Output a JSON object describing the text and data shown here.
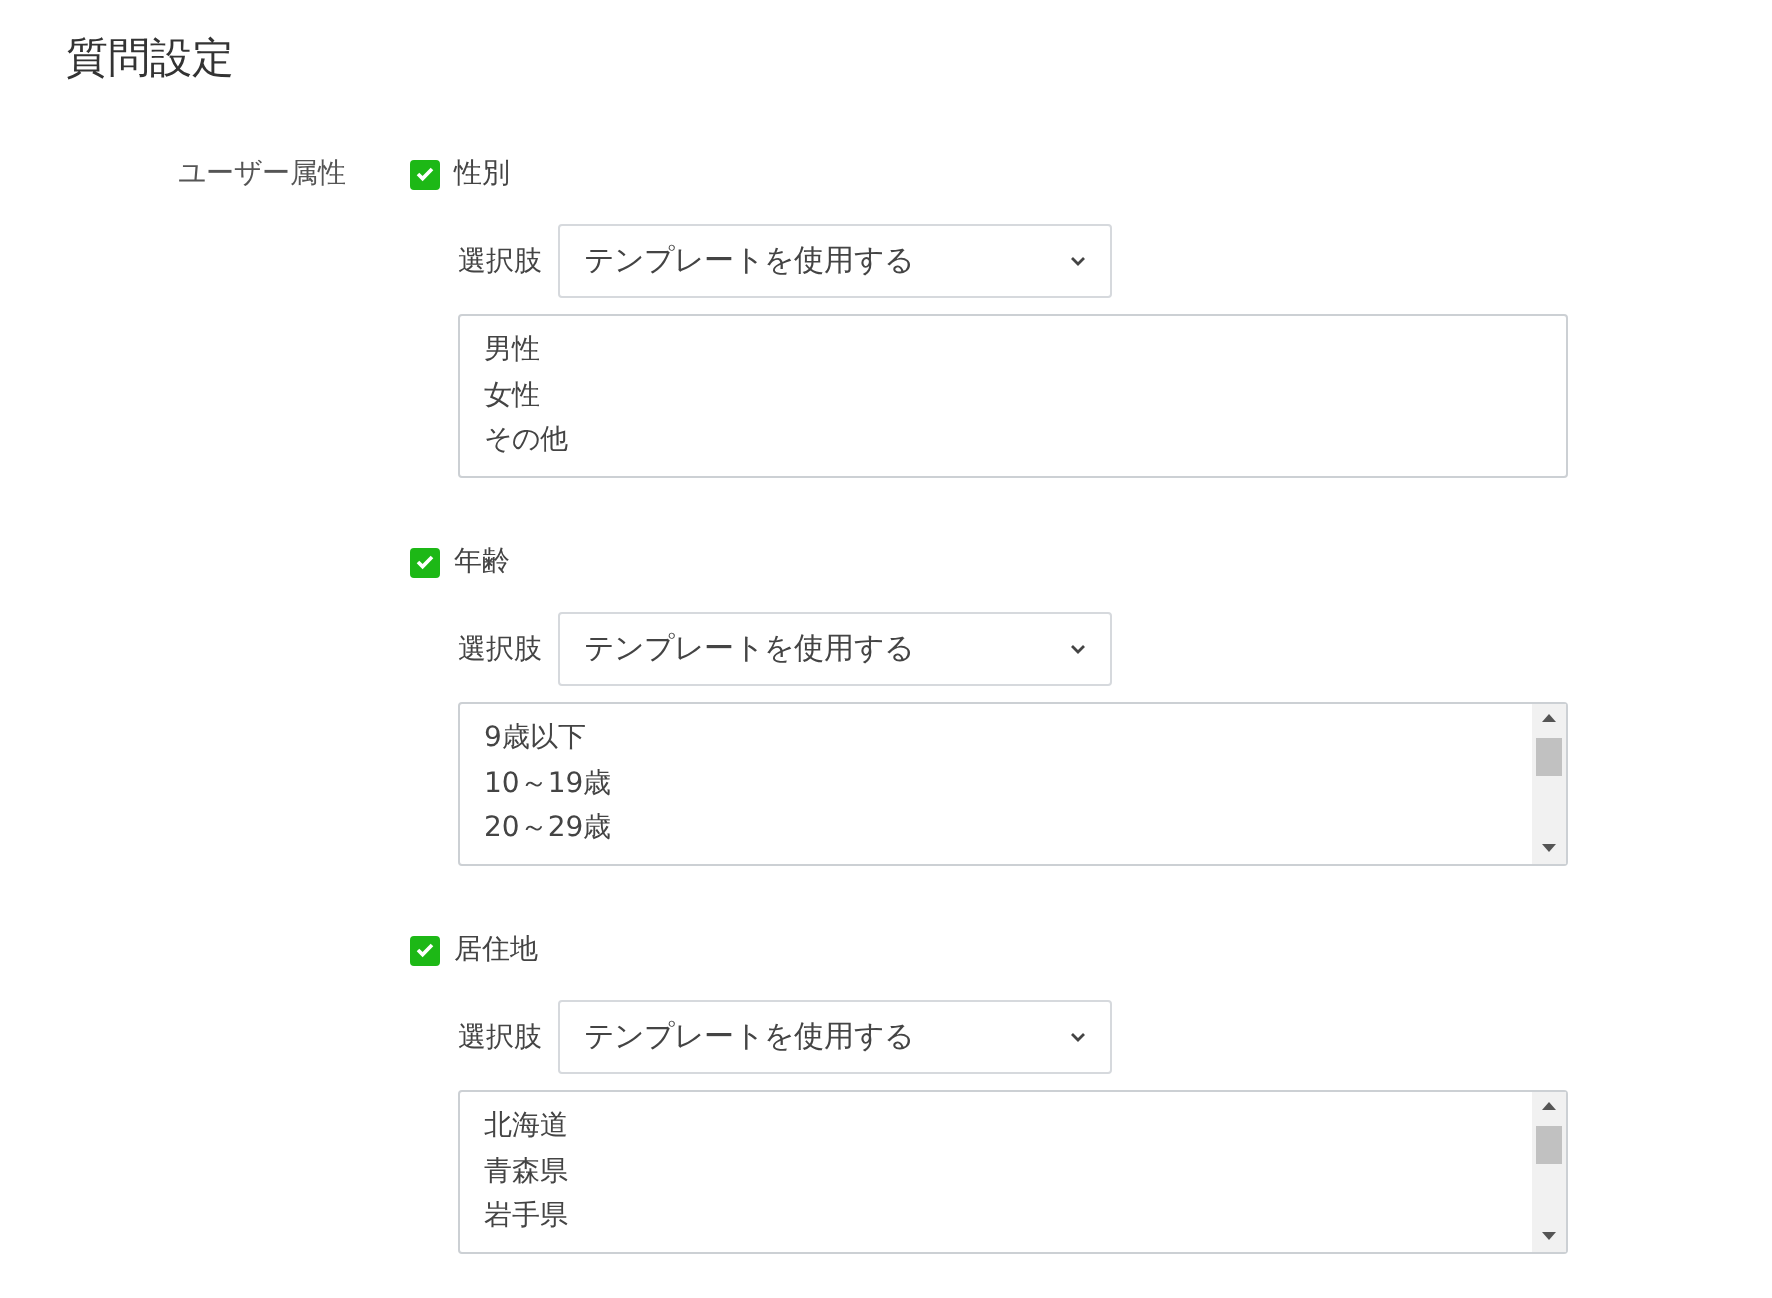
{
  "title": "質問設定",
  "group_label": "ユーザー属性",
  "attributes": [
    {
      "label": "性別",
      "checked": true,
      "choices_label": "選択肢",
      "select_value": "テンプレートを使用する",
      "options": [
        "男性",
        "女性",
        "その他"
      ],
      "scrollable": false
    },
    {
      "label": "年齢",
      "checked": true,
      "choices_label": "選択肢",
      "select_value": "テンプレートを使用する",
      "options": [
        "9歳以下",
        "10～19歳",
        "20～29歳"
      ],
      "scrollable": true
    },
    {
      "label": "居住地",
      "checked": true,
      "choices_label": "選択肢",
      "select_value": "テンプレートを使用する",
      "options": [
        "北海道",
        "青森県",
        "岩手県"
      ],
      "scrollable": true
    }
  ]
}
